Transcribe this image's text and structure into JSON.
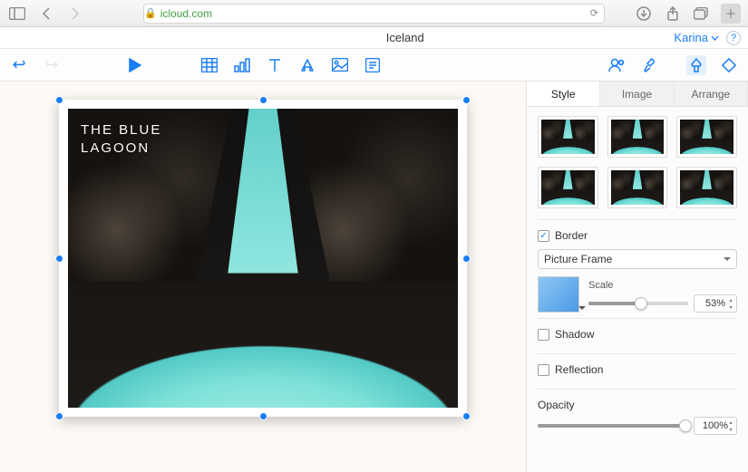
{
  "browser": {
    "url_host": "icloud.com"
  },
  "document": {
    "title": "Iceland"
  },
  "user": {
    "name": "Karina"
  },
  "slide": {
    "caption": "THE BLUE\nLAGOON"
  },
  "inspector": {
    "tabs": {
      "style": "Style",
      "image": "Image",
      "arrange": "Arrange"
    },
    "border": {
      "label": "Border",
      "checked": true,
      "style_select": "Picture Frame",
      "scale_label": "Scale",
      "scale_value": "53%",
      "scale_pct": 53
    },
    "shadow": {
      "label": "Shadow",
      "checked": false
    },
    "reflection": {
      "label": "Reflection",
      "checked": false
    },
    "opacity": {
      "label": "Opacity",
      "value": "100%",
      "pct": 100
    }
  }
}
